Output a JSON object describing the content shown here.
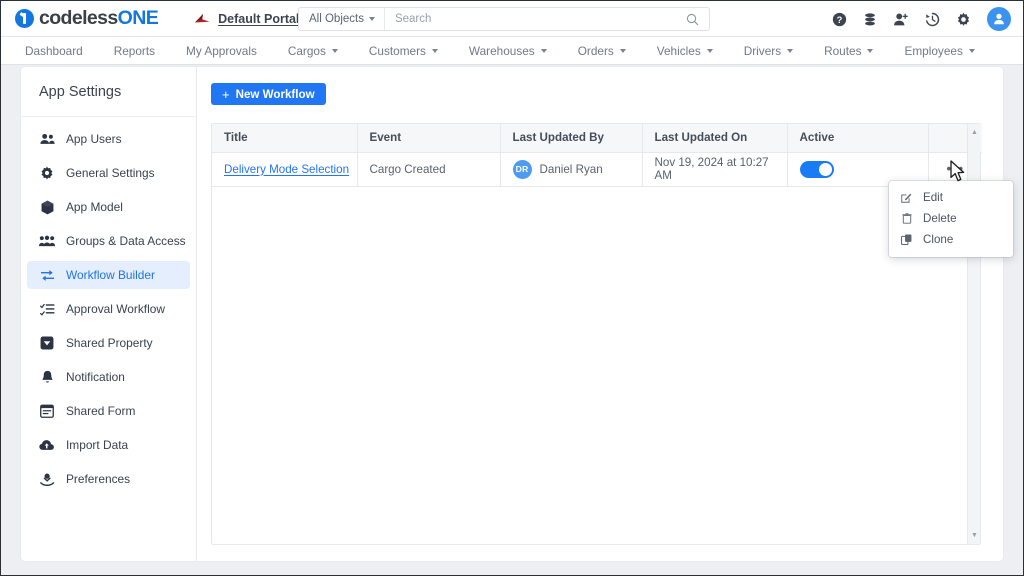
{
  "header": {
    "logo": {
      "icon": "codeless-one-logo-icon",
      "text_primary": "codeless",
      "text_accent": "ONE"
    },
    "portal": {
      "icon": "portal-arrow-icon",
      "label": "Default Portal"
    },
    "search": {
      "scope_label": "All Objects",
      "placeholder": "Search",
      "value": "",
      "icon": "search-icon"
    },
    "icons": [
      {
        "name": "help-icon",
        "title": "Help"
      },
      {
        "name": "database-icon",
        "title": "Data"
      },
      {
        "name": "add-user-icon",
        "title": "Add User"
      },
      {
        "name": "history-icon",
        "title": "History"
      },
      {
        "name": "gear-icon",
        "title": "Settings"
      }
    ],
    "avatar": {
      "name": "user-avatar",
      "icon": "person-icon"
    }
  },
  "nav": {
    "items": [
      {
        "label": "Dashboard",
        "has_caret": false
      },
      {
        "label": "Reports",
        "has_caret": false
      },
      {
        "label": "My Approvals",
        "has_caret": false
      },
      {
        "label": "Cargos",
        "has_caret": true
      },
      {
        "label": "Customers",
        "has_caret": true
      },
      {
        "label": "Warehouses",
        "has_caret": true
      },
      {
        "label": "Orders",
        "has_caret": true
      },
      {
        "label": "Vehicles",
        "has_caret": true
      },
      {
        "label": "Drivers",
        "has_caret": true
      },
      {
        "label": "Routes",
        "has_caret": true
      },
      {
        "label": "Employees",
        "has_caret": true
      }
    ]
  },
  "sidebar": {
    "title": "App Settings",
    "items": [
      {
        "label": "App Users",
        "icon": "users-icon",
        "active": false
      },
      {
        "label": "General Settings",
        "icon": "gear-icon",
        "active": false
      },
      {
        "label": "App Model",
        "icon": "cube-icon",
        "active": false
      },
      {
        "label": "Groups & Data Access",
        "icon": "group-users-icon",
        "active": false
      },
      {
        "label": "Workflow Builder",
        "icon": "workflow-arrows-icon",
        "active": true
      },
      {
        "label": "Approval Workflow",
        "icon": "checklist-icon",
        "active": false
      },
      {
        "label": "Shared Property",
        "icon": "shared-property-icon",
        "active": false
      },
      {
        "label": "Notification",
        "icon": "bell-icon",
        "active": false
      },
      {
        "label": "Shared Form",
        "icon": "form-icon",
        "active": false
      },
      {
        "label": "Import Data",
        "icon": "cloud-upload-icon",
        "active": false
      },
      {
        "label": "Preferences",
        "icon": "preferences-hand-icon",
        "active": false
      }
    ]
  },
  "main": {
    "new_button": {
      "label": "New Workflow",
      "icon": "plus-icon"
    },
    "table": {
      "columns": [
        "Title",
        "Event",
        "Last Updated By",
        "Last Updated On",
        "Active",
        ""
      ],
      "rows": [
        {
          "title": "Delivery Mode Selection",
          "event": "Cargo Created",
          "updated_by": {
            "initials": "DR",
            "name": "Daniel Ryan"
          },
          "updated_on": "Nov 19, 2024 at 10:27 AM",
          "active": true,
          "actions_icon": "more-actions-icon"
        }
      ]
    },
    "scrollbar": {
      "up_icon": "scroll-up-arrow-icon",
      "down_icon": "scroll-down-arrow-icon"
    }
  },
  "context_menu": {
    "items": [
      {
        "label": "Edit",
        "icon": "edit-pencil-icon"
      },
      {
        "label": "Delete",
        "icon": "trash-icon"
      },
      {
        "label": "Clone",
        "icon": "copy-icon"
      }
    ]
  },
  "colors": {
    "accent_blue": "#2176f3",
    "toggle_on": "#1a7cf5",
    "sidebar_active_bg": "#e4eefc",
    "sidebar_active_text": "#1f74dd",
    "avatar_blue": "#4e9bf0",
    "page_bg": "#edeff2",
    "portal_red": "#b32424"
  }
}
